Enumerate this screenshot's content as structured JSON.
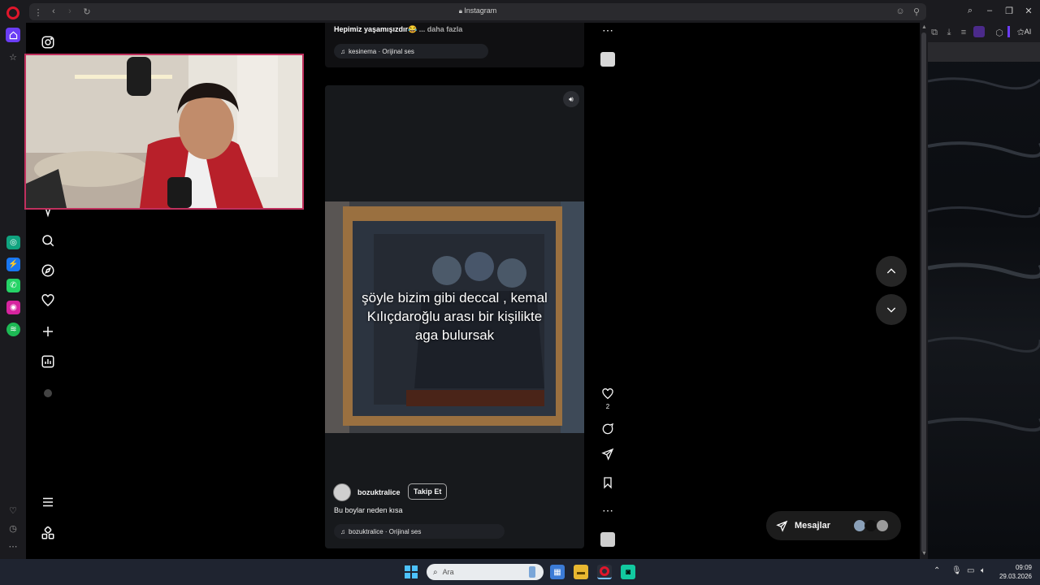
{
  "browser": {
    "address_title": "Instagram",
    "right_tab_label": "AI"
  },
  "reel_top": {
    "caption": "Hepimiz yaşamışızdır😂",
    "more_label": "... daha fazla",
    "audio": "kesinema · Orijinal ses"
  },
  "reel": {
    "overlay_text_line1": "şöyle bizim gibi deccal , kemal",
    "overlay_text_line2": "Kılıçdaroğlu arası bir kişilikte",
    "overlay_text_line3": "aga bulursak",
    "username": "bozuktralice",
    "follow_label": "Takip Et",
    "caption": "Bu boylar neden kısa",
    "audio": "bozuktralice · Orijinal ses",
    "like_count": "2"
  },
  "messages": {
    "label": "Mesajlar"
  },
  "taskbar": {
    "search_placeholder": "Ara",
    "time": "09:09",
    "date": "29.03.2026"
  },
  "colors": {
    "opera_red": "#e0162b",
    "accent_purple": "#6b3df5",
    "webcam_border": "#c0305e"
  }
}
